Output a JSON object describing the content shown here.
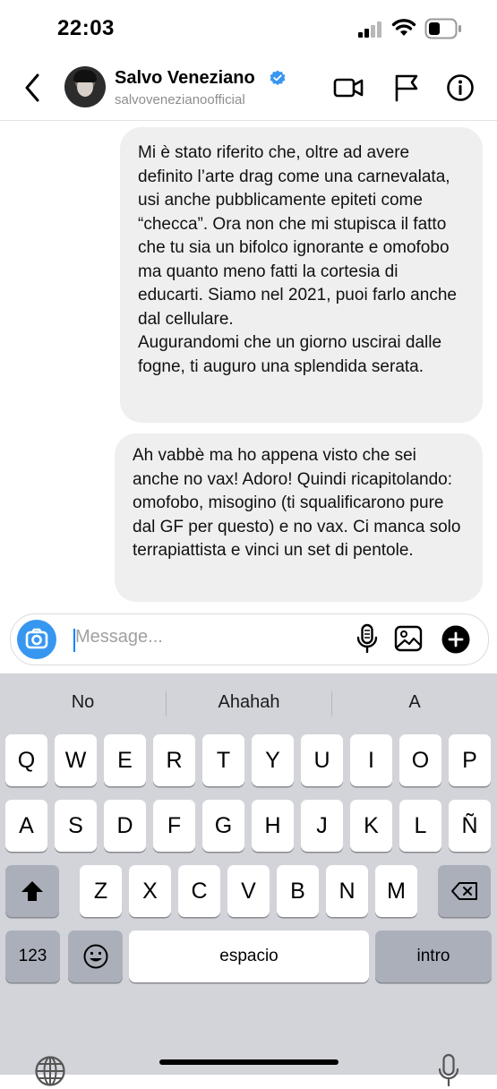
{
  "status_bar": {
    "time": "22:03"
  },
  "header": {
    "name": "Salvo Veneziano",
    "username": "salvovenezianoofficial",
    "icons": [
      "back-chevron-icon",
      "verified-badge-icon",
      "video-call-icon",
      "flag-icon",
      "info-icon"
    ]
  },
  "messages": [
    {
      "text": "Mi è stato riferito che, oltre ad avere definito l’arte drag come una carnevalata, usi anche pubblicamente epiteti come “checca”. Ora non che mi stupisca il fatto che tu sia un bifolco ignorante e omofobo ma quanto meno fatti la cortesia di educarti. Siamo nel 2021, puoi farlo anche dal cellulare.\nAugurandomi che un giorno uscirai dalle fogne, ti auguro una splendida serata."
    },
    {
      "text": "Ah vabbè ma ho appena visto che sei anche no vax! Adoro! Quindi ricapitolando: omofobo, misogino (ti squalificarono pure dal GF per questo) e no vax. Ci manca solo terrapiattista e vinci un set di pentole."
    }
  ],
  "composer": {
    "placeholder": "Message...",
    "icons": [
      "camera-icon",
      "microphone-icon",
      "gallery-icon",
      "add-icon"
    ]
  },
  "keyboard": {
    "suggestions": [
      "No",
      "Ahahah",
      "A"
    ],
    "row1": [
      "Q",
      "W",
      "E",
      "R",
      "T",
      "Y",
      "U",
      "I",
      "O",
      "P"
    ],
    "row2": [
      "A",
      "S",
      "D",
      "F",
      "G",
      "H",
      "J",
      "K",
      "L",
      "Ñ"
    ],
    "row3": [
      "Z",
      "X",
      "C",
      "V",
      "B",
      "N",
      "M"
    ],
    "numbers_key": "123",
    "space_key": "espacio",
    "return_key": "intro",
    "colors": {
      "background": "#d2d4da",
      "key": "#ffffff",
      "function_key": "#abafba"
    }
  },
  "colors": {
    "accent": "#3797f0",
    "bubble": "#efefef",
    "verified": "#3897f0"
  }
}
